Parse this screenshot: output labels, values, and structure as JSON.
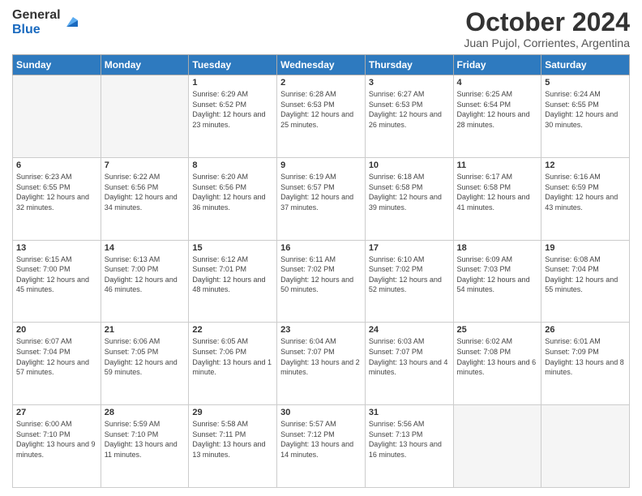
{
  "logo": {
    "general": "General",
    "blue": "Blue"
  },
  "header": {
    "month": "October 2024",
    "location": "Juan Pujol, Corrientes, Argentina"
  },
  "weekdays": [
    "Sunday",
    "Monday",
    "Tuesday",
    "Wednesday",
    "Thursday",
    "Friday",
    "Saturday"
  ],
  "weeks": [
    [
      {
        "day": "",
        "info": ""
      },
      {
        "day": "",
        "info": ""
      },
      {
        "day": "1",
        "info": "Sunrise: 6:29 AM\nSunset: 6:52 PM\nDaylight: 12 hours and 23 minutes."
      },
      {
        "day": "2",
        "info": "Sunrise: 6:28 AM\nSunset: 6:53 PM\nDaylight: 12 hours and 25 minutes."
      },
      {
        "day": "3",
        "info": "Sunrise: 6:27 AM\nSunset: 6:53 PM\nDaylight: 12 hours and 26 minutes."
      },
      {
        "day": "4",
        "info": "Sunrise: 6:25 AM\nSunset: 6:54 PM\nDaylight: 12 hours and 28 minutes."
      },
      {
        "day": "5",
        "info": "Sunrise: 6:24 AM\nSunset: 6:55 PM\nDaylight: 12 hours and 30 minutes."
      }
    ],
    [
      {
        "day": "6",
        "info": "Sunrise: 6:23 AM\nSunset: 6:55 PM\nDaylight: 12 hours and 32 minutes."
      },
      {
        "day": "7",
        "info": "Sunrise: 6:22 AM\nSunset: 6:56 PM\nDaylight: 12 hours and 34 minutes."
      },
      {
        "day": "8",
        "info": "Sunrise: 6:20 AM\nSunset: 6:56 PM\nDaylight: 12 hours and 36 minutes."
      },
      {
        "day": "9",
        "info": "Sunrise: 6:19 AM\nSunset: 6:57 PM\nDaylight: 12 hours and 37 minutes."
      },
      {
        "day": "10",
        "info": "Sunrise: 6:18 AM\nSunset: 6:58 PM\nDaylight: 12 hours and 39 minutes."
      },
      {
        "day": "11",
        "info": "Sunrise: 6:17 AM\nSunset: 6:58 PM\nDaylight: 12 hours and 41 minutes."
      },
      {
        "day": "12",
        "info": "Sunrise: 6:16 AM\nSunset: 6:59 PM\nDaylight: 12 hours and 43 minutes."
      }
    ],
    [
      {
        "day": "13",
        "info": "Sunrise: 6:15 AM\nSunset: 7:00 PM\nDaylight: 12 hours and 45 minutes."
      },
      {
        "day": "14",
        "info": "Sunrise: 6:13 AM\nSunset: 7:00 PM\nDaylight: 12 hours and 46 minutes."
      },
      {
        "day": "15",
        "info": "Sunrise: 6:12 AM\nSunset: 7:01 PM\nDaylight: 12 hours and 48 minutes."
      },
      {
        "day": "16",
        "info": "Sunrise: 6:11 AM\nSunset: 7:02 PM\nDaylight: 12 hours and 50 minutes."
      },
      {
        "day": "17",
        "info": "Sunrise: 6:10 AM\nSunset: 7:02 PM\nDaylight: 12 hours and 52 minutes."
      },
      {
        "day": "18",
        "info": "Sunrise: 6:09 AM\nSunset: 7:03 PM\nDaylight: 12 hours and 54 minutes."
      },
      {
        "day": "19",
        "info": "Sunrise: 6:08 AM\nSunset: 7:04 PM\nDaylight: 12 hours and 55 minutes."
      }
    ],
    [
      {
        "day": "20",
        "info": "Sunrise: 6:07 AM\nSunset: 7:04 PM\nDaylight: 12 hours and 57 minutes."
      },
      {
        "day": "21",
        "info": "Sunrise: 6:06 AM\nSunset: 7:05 PM\nDaylight: 12 hours and 59 minutes."
      },
      {
        "day": "22",
        "info": "Sunrise: 6:05 AM\nSunset: 7:06 PM\nDaylight: 13 hours and 1 minute."
      },
      {
        "day": "23",
        "info": "Sunrise: 6:04 AM\nSunset: 7:07 PM\nDaylight: 13 hours and 2 minutes."
      },
      {
        "day": "24",
        "info": "Sunrise: 6:03 AM\nSunset: 7:07 PM\nDaylight: 13 hours and 4 minutes."
      },
      {
        "day": "25",
        "info": "Sunrise: 6:02 AM\nSunset: 7:08 PM\nDaylight: 13 hours and 6 minutes."
      },
      {
        "day": "26",
        "info": "Sunrise: 6:01 AM\nSunset: 7:09 PM\nDaylight: 13 hours and 8 minutes."
      }
    ],
    [
      {
        "day": "27",
        "info": "Sunrise: 6:00 AM\nSunset: 7:10 PM\nDaylight: 13 hours and 9 minutes."
      },
      {
        "day": "28",
        "info": "Sunrise: 5:59 AM\nSunset: 7:10 PM\nDaylight: 13 hours and 11 minutes."
      },
      {
        "day": "29",
        "info": "Sunrise: 5:58 AM\nSunset: 7:11 PM\nDaylight: 13 hours and 13 minutes."
      },
      {
        "day": "30",
        "info": "Sunrise: 5:57 AM\nSunset: 7:12 PM\nDaylight: 13 hours and 14 minutes."
      },
      {
        "day": "31",
        "info": "Sunrise: 5:56 AM\nSunset: 7:13 PM\nDaylight: 13 hours and 16 minutes."
      },
      {
        "day": "",
        "info": ""
      },
      {
        "day": "",
        "info": ""
      }
    ]
  ]
}
